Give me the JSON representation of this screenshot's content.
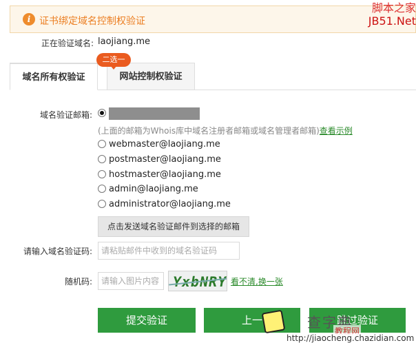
{
  "banner": {
    "title": "证书绑定域名控制权验证",
    "icon": "info-icon"
  },
  "watermark_top": {
    "line1": "脚本之家",
    "line2": "JB51.Net"
  },
  "domain": {
    "label": "正在验证域名:",
    "value": "laojiang.me"
  },
  "badge": "二选一",
  "tabs": [
    {
      "label": "域名所有权验证",
      "active": true
    },
    {
      "label": "网站控制权验证",
      "active": false
    }
  ],
  "email_section": {
    "label": "域名验证邮箱:",
    "hint": "(上面的邮箱为Whois库中域名注册者邮箱或域名管理者邮箱)",
    "hint_link": "查看示例",
    "options": [
      "webmaster@laojiang.me",
      "postmaster@laojiang.me",
      "hostmaster@laojiang.me",
      "admin@laojiang.me",
      "administrator@laojiang.me"
    ]
  },
  "send_button": "点击发送域名验证邮件到选择的邮箱",
  "code_field": {
    "label": "请输入域名验证码:",
    "placeholder": "请粘贴邮件中收到的域名验证码"
  },
  "captcha_field": {
    "label": "随机码:",
    "placeholder": "请输入图片内容",
    "captcha_text": "YxbNRY",
    "refresh_link": "看不清,换一张"
  },
  "buttons": {
    "submit": "提交验证",
    "prev": "上一",
    "skip": "跳过验证"
  },
  "watermark_bottom": {
    "text": "查字典",
    "tag": "教程网",
    "url": "http://jiaocheng.chazidian.com"
  }
}
